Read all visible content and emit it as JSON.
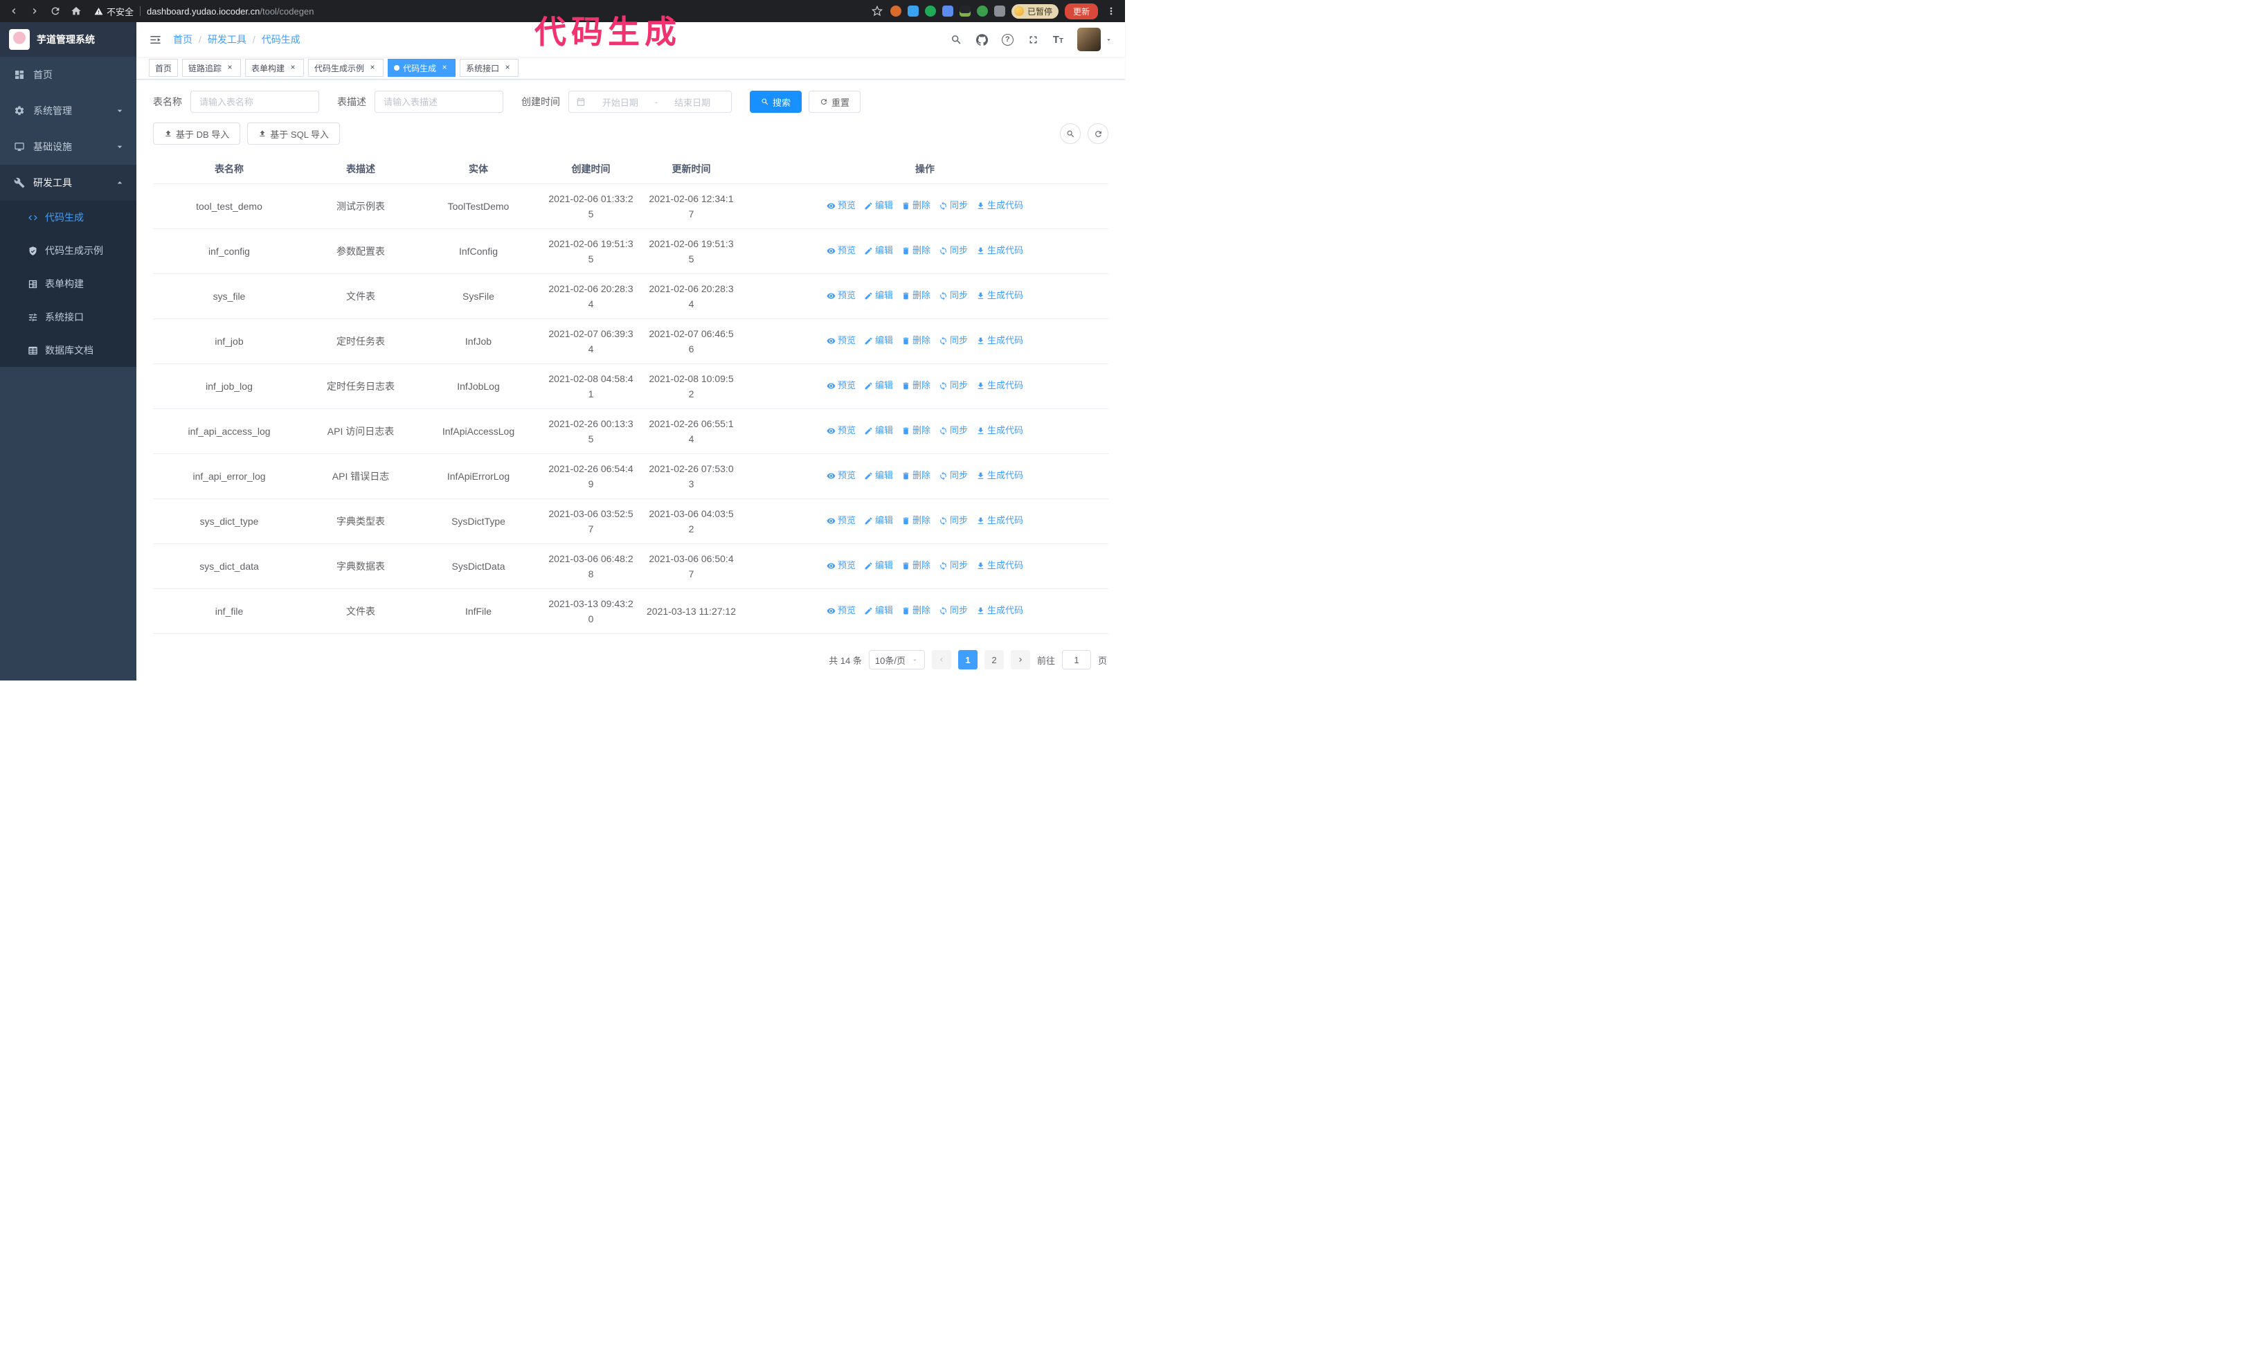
{
  "browser": {
    "warning_text": "不安全",
    "url_host": "dashboard.yudao.iocoder.cn",
    "url_path": "/tool/codegen",
    "paused_badge": "已暂停",
    "update_button": "更新"
  },
  "annotation": {
    "title": "代码生成",
    "color": "#f2326e"
  },
  "sidebar": {
    "logo_title": "芋道管理系统",
    "items": [
      {
        "label": "首页",
        "icon": "dashboard-icon"
      },
      {
        "label": "系统管理",
        "icon": "gear-icon"
      },
      {
        "label": "基础设施",
        "icon": "monitor-icon"
      },
      {
        "label": "研发工具",
        "icon": "tools-icon"
      }
    ],
    "submenu": [
      {
        "label": "代码生成",
        "icon": "code-icon",
        "active": true
      },
      {
        "label": "代码生成示例",
        "icon": "shield-icon"
      },
      {
        "label": "表单构建",
        "icon": "form-icon"
      },
      {
        "label": "系统接口",
        "icon": "api-icon"
      },
      {
        "label": "数据库文档",
        "icon": "database-icon"
      }
    ]
  },
  "navbar": {
    "breadcrumb": [
      {
        "label": "首页"
      },
      {
        "label": "研发工具"
      },
      {
        "label": "代码生成"
      }
    ]
  },
  "tabs": [
    {
      "label": "首页",
      "closable": false,
      "active": false
    },
    {
      "label": "链路追踪",
      "closable": true,
      "active": false
    },
    {
      "label": "表单构建",
      "closable": true,
      "active": false
    },
    {
      "label": "代码生成示例",
      "closable": true,
      "active": false
    },
    {
      "label": "代码生成",
      "closable": true,
      "active": true
    },
    {
      "label": "系统接口",
      "closable": true,
      "active": false
    }
  ],
  "filters": {
    "table_name_label": "表名称",
    "table_name_placeholder": "请输入表名称",
    "table_desc_label": "表描述",
    "table_desc_placeholder": "请输入表描述",
    "create_time_label": "创建时间",
    "date_start_placeholder": "开始日期",
    "date_separator": "-",
    "date_end_placeholder": "结束日期",
    "search_button": "搜索",
    "reset_button": "重置"
  },
  "toolbar": {
    "import_db_button": "基于 DB 导入",
    "import_sql_button": "基于 SQL 导入"
  },
  "table": {
    "columns": [
      "表名称",
      "表描述",
      "实体",
      "创建时间",
      "更新时间",
      "操作"
    ],
    "actions": [
      {
        "label": "预览",
        "icon": "eye"
      },
      {
        "label": "编辑",
        "icon": "edit"
      },
      {
        "label": "删除",
        "icon": "trash"
      },
      {
        "label": "同步",
        "icon": "sync"
      },
      {
        "label": "生成代码",
        "icon": "download"
      }
    ],
    "rows": [
      {
        "name": "tool_test_demo",
        "desc": "测试示例表",
        "entity": "ToolTestDemo",
        "created": "2021-02-06 01:33:25",
        "updated": "2021-02-06 12:34:17"
      },
      {
        "name": "inf_config",
        "desc": "参数配置表",
        "entity": "InfConfig",
        "created": "2021-02-06 19:51:35",
        "updated": "2021-02-06 19:51:35"
      },
      {
        "name": "sys_file",
        "desc": "文件表",
        "entity": "SysFile",
        "created": "2021-02-06 20:28:34",
        "updated": "2021-02-06 20:28:34"
      },
      {
        "name": "inf_job",
        "desc": "定时任务表",
        "entity": "InfJob",
        "created": "2021-02-07 06:39:34",
        "updated": "2021-02-07 06:46:56"
      },
      {
        "name": "inf_job_log",
        "desc": "定时任务日志表",
        "entity": "InfJobLog",
        "created": "2021-02-08 04:58:41",
        "updated": "2021-02-08 10:09:52"
      },
      {
        "name": "inf_api_access_log",
        "desc": "API 访问日志表",
        "entity": "InfApiAccessLog",
        "created": "2021-02-26 00:13:35",
        "updated": "2021-02-26 06:55:14"
      },
      {
        "name": "inf_api_error_log",
        "desc": "API 错误日志",
        "entity": "InfApiErrorLog",
        "created": "2021-02-26 06:54:49",
        "updated": "2021-02-26 07:53:03"
      },
      {
        "name": "sys_dict_type",
        "desc": "字典类型表",
        "entity": "SysDictType",
        "created": "2021-03-06 03:52:57",
        "updated": "2021-03-06 04:03:52"
      },
      {
        "name": "sys_dict_data",
        "desc": "字典数据表",
        "entity": "SysDictData",
        "created": "2021-03-06 06:48:28",
        "updated": "2021-03-06 06:50:47"
      },
      {
        "name": "inf_file",
        "desc": "文件表",
        "entity": "InfFile",
        "created": "2021-03-13 09:43:20",
        "updated": "2021-03-13 11:27:12"
      }
    ]
  },
  "pagination": {
    "total_text": "共 14 条",
    "page_size": "10条/页",
    "pages": [
      "1",
      "2"
    ],
    "active_page": "1",
    "goto_label": "前往",
    "goto_value": "1",
    "goto_unit": "页"
  },
  "colors": {
    "primary": "#409eff",
    "search_button": "#1890ff",
    "sidebar_bg": "#304156",
    "submenu_bg": "#1f2d3d",
    "annotation": "#f2326e"
  }
}
